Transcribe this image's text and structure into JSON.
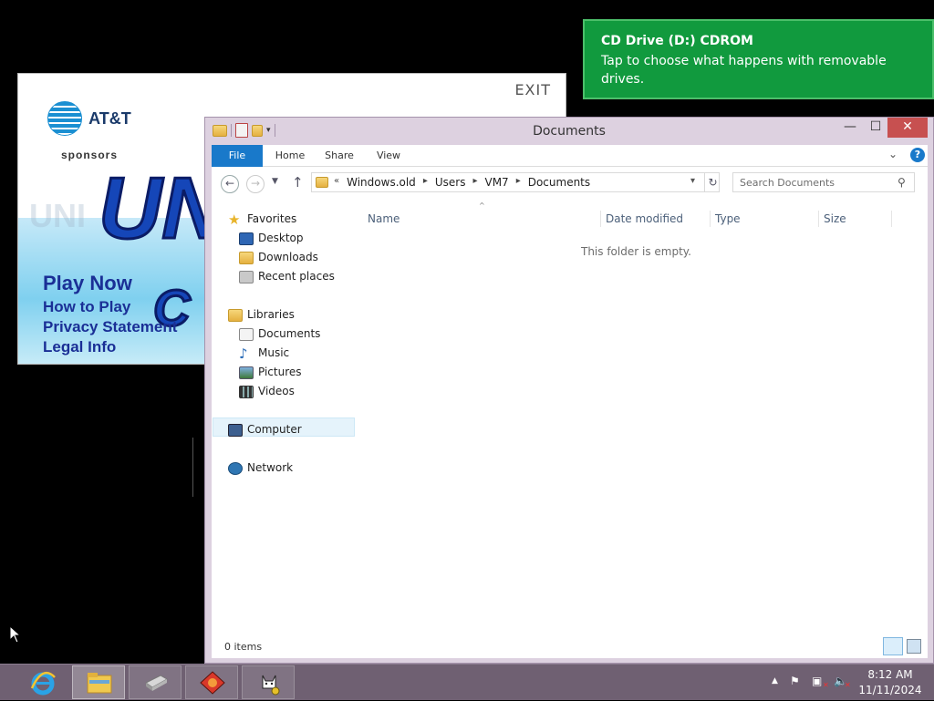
{
  "promo": {
    "exit_label": "EXIT",
    "brand": "AT&T",
    "sponsors": "sponsors",
    "big_text": "UN",
    "big_text_2": "C",
    "links": [
      "Play Now",
      "How to Play",
      "Privacy Statement",
      "Legal Info"
    ]
  },
  "toast": {
    "title": "CD Drive (D:) CDROM",
    "body": "Tap to choose what happens with removable drives.",
    "color": "#119a3e"
  },
  "explorer": {
    "title": "Documents",
    "caption": {
      "minimize": "—",
      "maximize": "☐",
      "close": "✕"
    },
    "ribbon": {
      "file": "File",
      "home": "Home",
      "share": "Share",
      "view": "View",
      "help": "?"
    },
    "breadcrumb": [
      "«",
      "Windows.old",
      "Users",
      "VM7",
      "Documents"
    ],
    "search_placeholder": "Search Documents",
    "nav": {
      "favorites": "Favorites",
      "desktop": "Desktop",
      "downloads": "Downloads",
      "recent": "Recent places",
      "libraries": "Libraries",
      "documents": "Documents",
      "music": "Music",
      "pictures": "Pictures",
      "videos": "Videos",
      "computer": "Computer",
      "network": "Network"
    },
    "columns": [
      "Name",
      "Date modified",
      "Type",
      "Size"
    ],
    "empty_message": "This folder is empty.",
    "status": "0 items",
    "accent": "#1979ca"
  },
  "taskbar": {
    "color": "#6f6072",
    "apps": [
      "internet-explorer-icon",
      "file-explorer-icon",
      "drive-icon",
      "game-icon",
      "cat-icon"
    ],
    "time": "8:12 AM",
    "date": "11/11/2024"
  }
}
